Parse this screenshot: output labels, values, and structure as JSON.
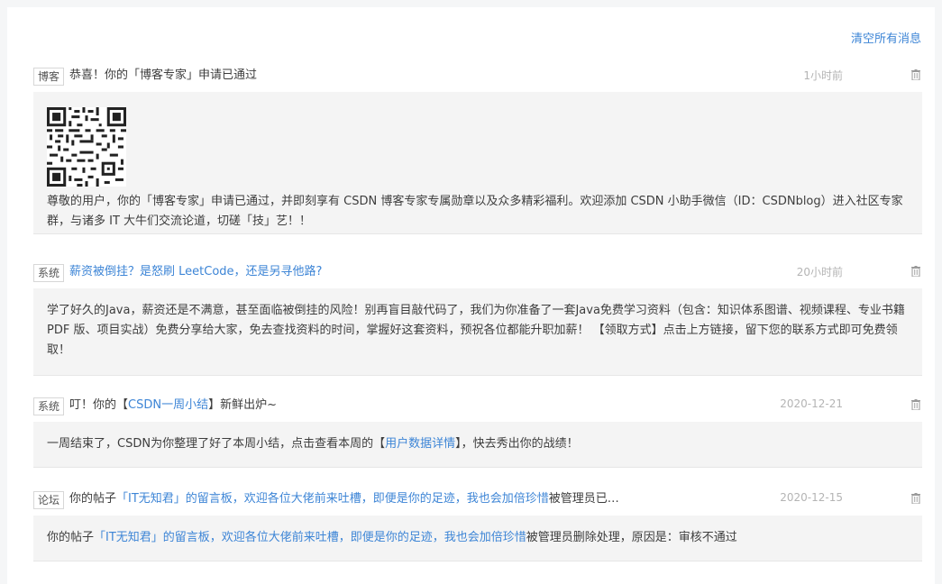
{
  "header": {
    "clear_all": "清空所有消息"
  },
  "messages": [
    {
      "tag": "博客",
      "title": "恭喜！你的「博客专家」申请已通过",
      "time": "1小时前",
      "body": "尊敬的用户，你的「博客专家」申请已通过，并即刻享有 CSDN 博客专家专属勋章以及众多精彩福利。欢迎添加 CSDN 小助手微信（ID：CSDNblog）进入社区专家群，与诸多 IT 大牛们交流论道，切磋「技」艺！！"
    },
    {
      "tag": "系统",
      "title_link": "薪资被倒挂？是怒刷 LeetCode，还是另寻他路?",
      "time": "20小时前",
      "body": "学了好久的Java，薪资还是不满意，甚至面临被倒挂的风险！别再盲目敲代码了，我们为你准备了一套Java免费学习资料（包含：知识体系图谱、视频课程、专业书籍 PDF 版、项目实战）免费分享给大家，免去查找资料的时间，掌握好这套资料，预祝各位都能升职加薪！ 【领取方式】点击上方链接，留下您的联系方式即可免费领取！"
    },
    {
      "tag": "系统",
      "title_pre": "叮！你的【",
      "title_link": "CSDN一周小结",
      "title_post": "】新鲜出炉~",
      "time": "2020-12-21",
      "body_pre": "一周结束了，CSDN为你整理了好了本周小结，点击查看本周的【",
      "body_link": "用户数据详情",
      "body_post": "】，快去秀出你的战绩！"
    },
    {
      "tag": "论坛",
      "title_pre": "你的帖子",
      "title_link": "「IT无知君」的留言板，欢迎各位大佬前来吐槽，即便是你的足迹，我也会加倍珍惜",
      "title_post": "被管理员已…",
      "time": "2020-12-15",
      "body_pre": "你的帖子",
      "body_link": "「IT无知君」的留言板，欢迎各位大佬前来吐槽，即便是你的足迹，我也会加倍珍惜",
      "body_post": "被管理员删除处理，原因是：审核不通过"
    }
  ]
}
